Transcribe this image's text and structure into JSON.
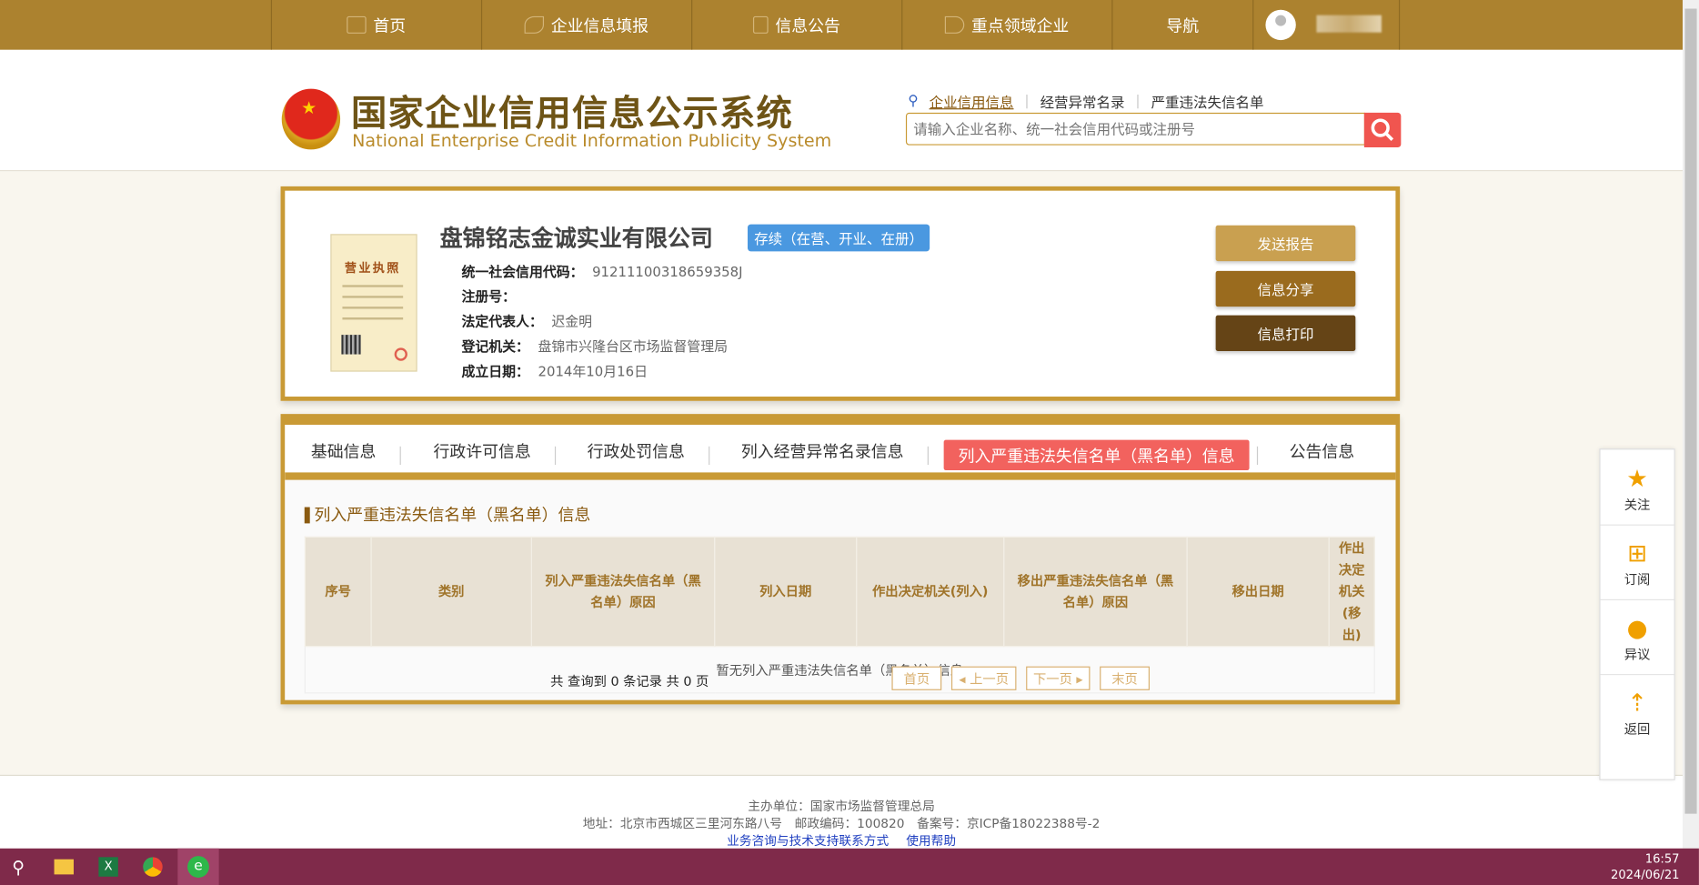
{
  "nav": {
    "items": [
      {
        "label": "首页",
        "icon": "monitor-icon"
      },
      {
        "label": "企业信息填报",
        "icon": "pen-icon"
      },
      {
        "label": "信息公告",
        "icon": "document-icon"
      },
      {
        "label": "重点领域企业",
        "icon": "speaker-icon"
      },
      {
        "label": "导航"
      }
    ]
  },
  "header": {
    "title": "国家企业信用信息公示系统",
    "subtitle": "National Enterprise Credit Information Publicity System",
    "search_links": [
      "企业信用信息",
      "经营异常名录",
      "严重违法失信名单"
    ],
    "search_placeholder": "请输入企业名称、统一社会信用代码或注册号"
  },
  "company": {
    "name": "盘锦铭志金诚实业有限公司",
    "status": "存续（在营、开业、在册）",
    "license_label": "营业执照",
    "fields": [
      {
        "label": "统一社会信用代码：",
        "value": "91211100318659358J"
      },
      {
        "label": "注册号：",
        "value": ""
      },
      {
        "label": "法定代表人：",
        "value": "迟金明"
      },
      {
        "label": "登记机关：",
        "value": "盘锦市兴隆台区市场监督管理局"
      },
      {
        "label": "成立日期：",
        "value": "2014年10月16日"
      }
    ],
    "actions": [
      "发送报告",
      "信息分享",
      "信息打印"
    ]
  },
  "tabs": [
    "基础信息",
    "行政许可信息",
    "行政处罚信息",
    "列入经营异常名录信息",
    "列入严重违法失信名单（黑名单）信息",
    "公告信息"
  ],
  "section": {
    "title": "列入严重违法失信名单（黑名单）信息",
    "columns": [
      "序号",
      "类别",
      "列入严重违法失信名单（黑名单）原因",
      "列入日期",
      "作出决定机关(列入)",
      "移出严重违法失信名单（黑名单）原因",
      "移出日期",
      "作出决定机关(移出)"
    ],
    "empty": "暂无列入严重违法失信名单（黑名单）信息",
    "page_info": "共 查询到 0 条记录 共 0 页",
    "pager": [
      "首页",
      "◂ 上一页",
      "下一页 ▸",
      "末页"
    ]
  },
  "footer": {
    "line1": "主办单位：国家市场监督管理总局",
    "line2": "地址：北京市西城区三里河东路八号　邮政编码：100820　备案号：京ICP备18022388号-2",
    "links": [
      "业务咨询与技术支持联系方式",
      "使用帮助"
    ]
  },
  "float": [
    "关注",
    "订阅",
    "异议",
    "返回"
  ],
  "clock": {
    "time": "16:57",
    "date": "2024/06/21"
  },
  "colors": {
    "nav": "#ac822f",
    "border": "#c99a35",
    "active_tab": "#f2625e",
    "badge": "#4a98e0"
  }
}
